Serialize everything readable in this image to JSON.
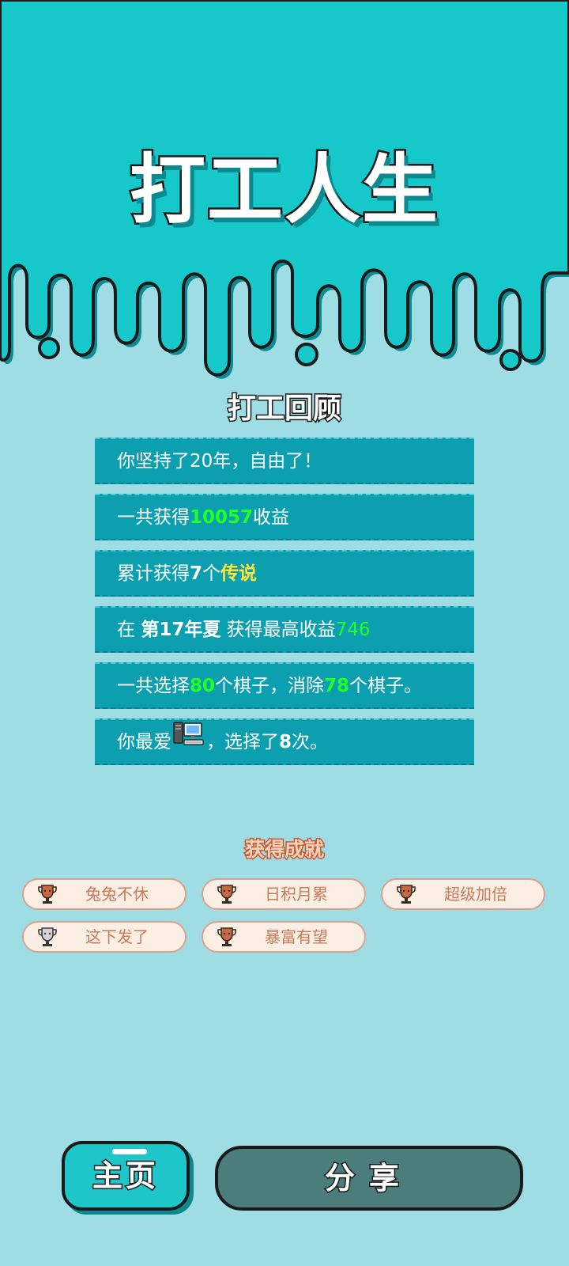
{
  "colors": {
    "top_teal": "#16c8c9",
    "page_bg": "#9edde4",
    "row_bg": "#0c9fb0",
    "highlight_green": "#22ff22",
    "highlight_yellow": "#ffe838",
    "achievement_text": "#c87a5a"
  },
  "game_title": "打工人生",
  "review": {
    "title": "打工回顾",
    "row1": {
      "text": "你坚持了20年，自由了！"
    },
    "row2": {
      "pre": "一共获得",
      "value": "10057",
      "post": "收益"
    },
    "row3": {
      "pre": "累计获得",
      "count": "7",
      "mid": "个",
      "rarity": "传说"
    },
    "row4": {
      "pre": "在 ",
      "season": "第17年夏",
      "mid": " 获得最高收益",
      "value": "746"
    },
    "row5": {
      "pre": "一共选择",
      "chosen": "80",
      "mid": "个棋子，消除",
      "removed": "78",
      "post": "个棋子。"
    },
    "row6": {
      "pre": "你最爱",
      "icon": "computer-icon",
      "mid": "，选择了",
      "count": "8",
      "post": "次。"
    }
  },
  "achievements": {
    "title": "获得成就",
    "items": [
      {
        "label": "兔兔不休",
        "trophy": "bronze"
      },
      {
        "label": "日积月累",
        "trophy": "bronze"
      },
      {
        "label": "超级加倍",
        "trophy": "bronze"
      },
      {
        "label": "这下发了",
        "trophy": "silver"
      },
      {
        "label": "暴富有望",
        "trophy": "bronze"
      }
    ]
  },
  "buttons": {
    "home": "主页",
    "share": "分享"
  }
}
